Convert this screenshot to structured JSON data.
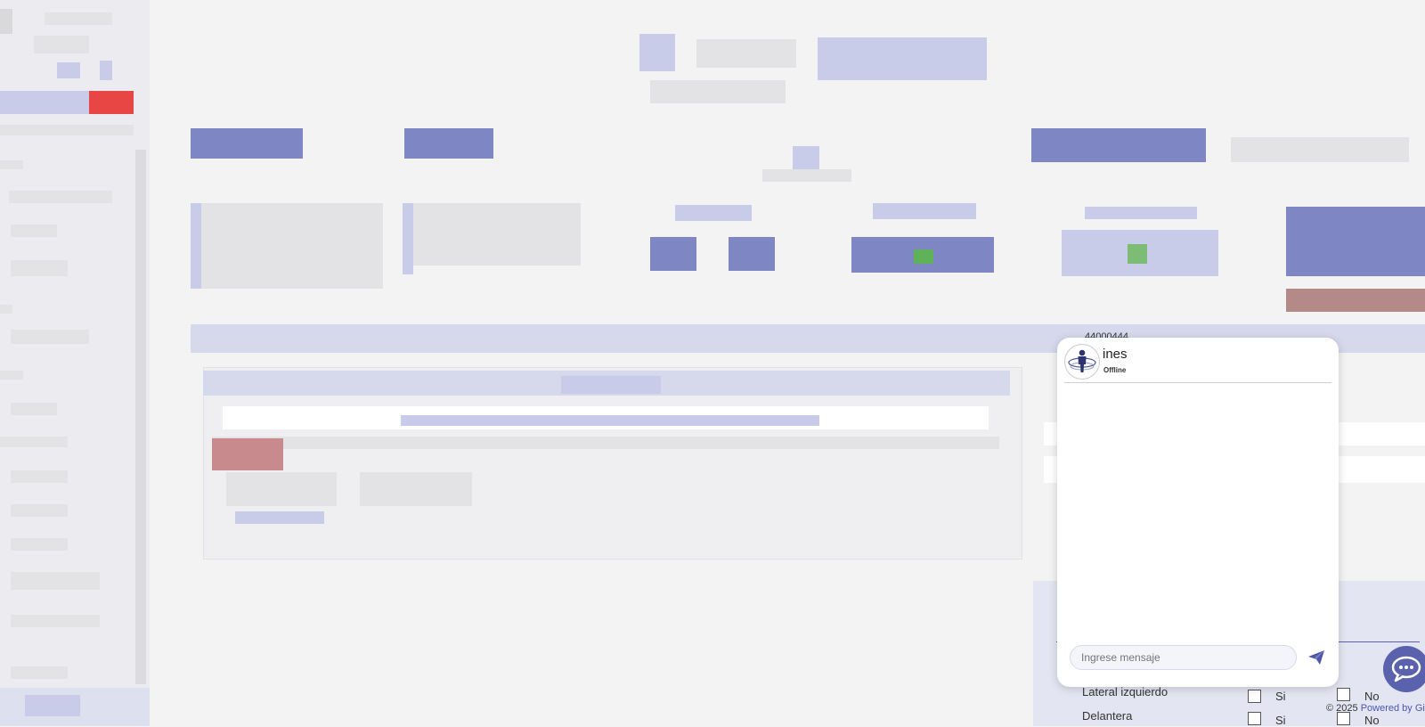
{
  "chat": {
    "contact_name": "ines",
    "status": "Offline",
    "input_placeholder": "Ingrese mensaje",
    "icons": {
      "avatar": "accessibility-person-icon",
      "send": "send-paper-plane-icon",
      "bubble": "chat-bubble-icon"
    }
  },
  "header_fragment": {
    "partial_number": "44000444"
  },
  "form_fragment": {
    "rows": [
      {
        "label": "Lateral izquierdo",
        "yes": "Si",
        "no": "No"
      },
      {
        "label": "Delantera",
        "yes": "Si",
        "no": "No"
      }
    ]
  },
  "footer": {
    "copyright": "© 2025",
    "powered_by": "Powered by Gis"
  },
  "colors": {
    "accent": "#5a62ad",
    "band": "#d6d9ec",
    "background": "#f3f3f3"
  }
}
